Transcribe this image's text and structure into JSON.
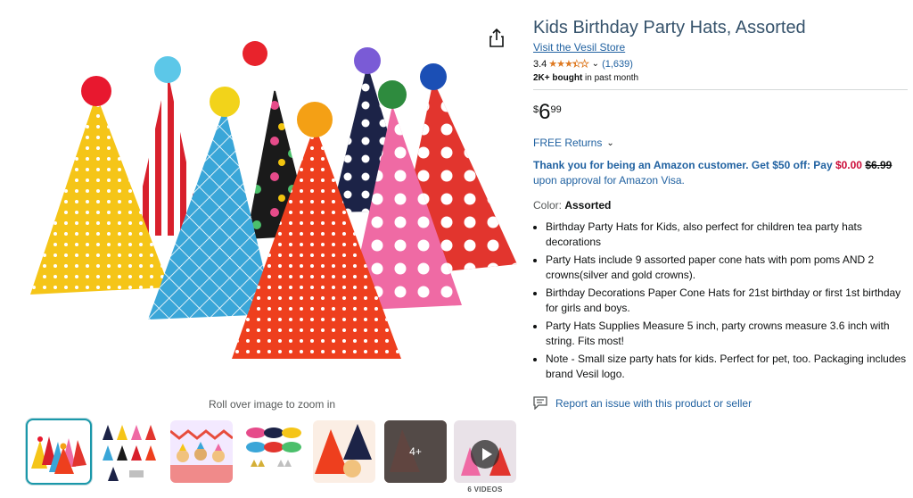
{
  "product": {
    "title": "Kids Birthday Party Hats, Assorted",
    "store_link": "Visit the Vesil Store",
    "rating": "3.4",
    "review_count": "(1,639)",
    "bought_bold": "2K+ bought",
    "bought_rest": " in past month",
    "price_symbol": "$",
    "price_whole": "6",
    "price_fraction": "99",
    "free_returns": "FREE Returns",
    "promo": {
      "part1": "Thank you for being an Amazon customer. Get $50 off: Pay ",
      "new_price": "$0.00",
      "old_price": "$6.99",
      "part2": " upon approval for Amazon Visa."
    },
    "color_label": "Color: ",
    "color_value": "Assorted",
    "bullets": [
      "Birthday Party Hats for Kids, also perfect for children tea party hats decorations",
      "Party Hats include 9 assorted paper cone hats with pom poms AND 2 crowns(silver and gold crowns).",
      "Birthday Decorations Paper Cone Hats for 21st birthday or first 1st birthday for girls and boys.",
      "Party Hats Supplies Measure 5 inch, party crowns measure 3.6 inch with string. Fits most!",
      "Note - Small size party hats for kids. Perfect for pet, too. Packaging includes brand Vesil logo."
    ],
    "report_link": "Report an issue with this product or seller"
  },
  "gallery": {
    "zoom_hint": "Roll over image to zoom in",
    "more_label": "4+",
    "videos_label": "6 VIDEOS"
  },
  "icons": {
    "share": "share-icon",
    "star": "star-icon",
    "chevron": "chevron-down-icon",
    "report": "report-message-icon",
    "play": "play-icon"
  },
  "colors": {
    "link": "#2162a1",
    "star": "#de7921",
    "deal_red": "#cc0c39",
    "selected_thumb": "#1a98aa"
  }
}
